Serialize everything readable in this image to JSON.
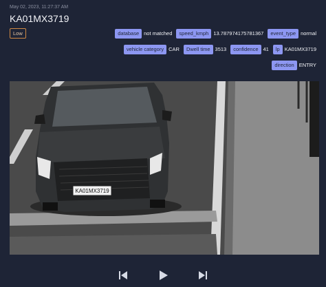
{
  "header": {
    "timestamp": "May 02, 2023, 11:27:37 AM",
    "title": "KA01MX3719",
    "severity": "Low"
  },
  "tags_row1": [
    {
      "key": "database",
      "value": "not matched"
    },
    {
      "key": "speed_kmph",
      "value": "13.787974175781367"
    },
    {
      "key": "event_type",
      "value": "normal"
    }
  ],
  "tags_row2": [
    {
      "key": "vehicle category",
      "value": "CAR"
    },
    {
      "key": "Dwell time",
      "value": "3513"
    },
    {
      "key": "confidence",
      "value": "41"
    },
    {
      "key": "lp",
      "value": "KA01MX3719"
    }
  ],
  "tags_row3": [
    {
      "key": "direction",
      "value": "ENTRY"
    }
  ],
  "video": {
    "plate_text": "KA01MX3719"
  },
  "controls": {
    "icons": [
      "skip-previous-icon",
      "play-icon",
      "skip-next-icon"
    ]
  },
  "colors": {
    "background": "#1e2436",
    "tag_key_bg": "#8d97f2",
    "severity_border": "#d08a43"
  }
}
